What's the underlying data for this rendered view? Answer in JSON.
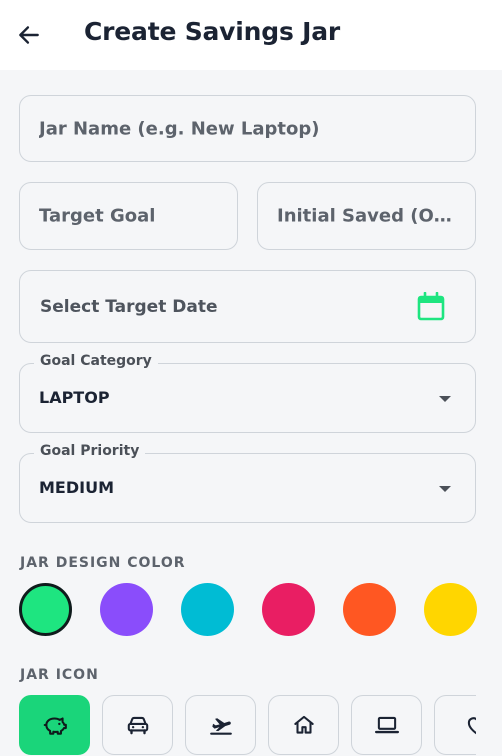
{
  "header": {
    "title": "Create Savings Jar"
  },
  "form": {
    "jar_name_placeholder": "Jar Name (e.g. New Laptop)",
    "target_goal_placeholder": "Target Goal",
    "initial_saved_placeholder": "Initial Saved (Optional)",
    "target_date_placeholder": "Select Target Date",
    "category": {
      "label": "Goal Category",
      "value": "LAPTOP"
    },
    "priority": {
      "label": "Goal Priority",
      "value": "MEDIUM"
    }
  },
  "design": {
    "color_label": "JAR DESIGN COLOR",
    "colors": [
      "#1ee580",
      "#8a4dfb",
      "#00bcd4",
      "#e91e63",
      "#ff5722",
      "#ffd600"
    ],
    "selected_color_index": 0,
    "icon_label": "JAR ICON",
    "icons": [
      "piggy-bank-icon",
      "car-icon",
      "flight-icon",
      "home-icon",
      "laptop-icon",
      "heart-icon"
    ],
    "selected_icon_index": 0
  }
}
